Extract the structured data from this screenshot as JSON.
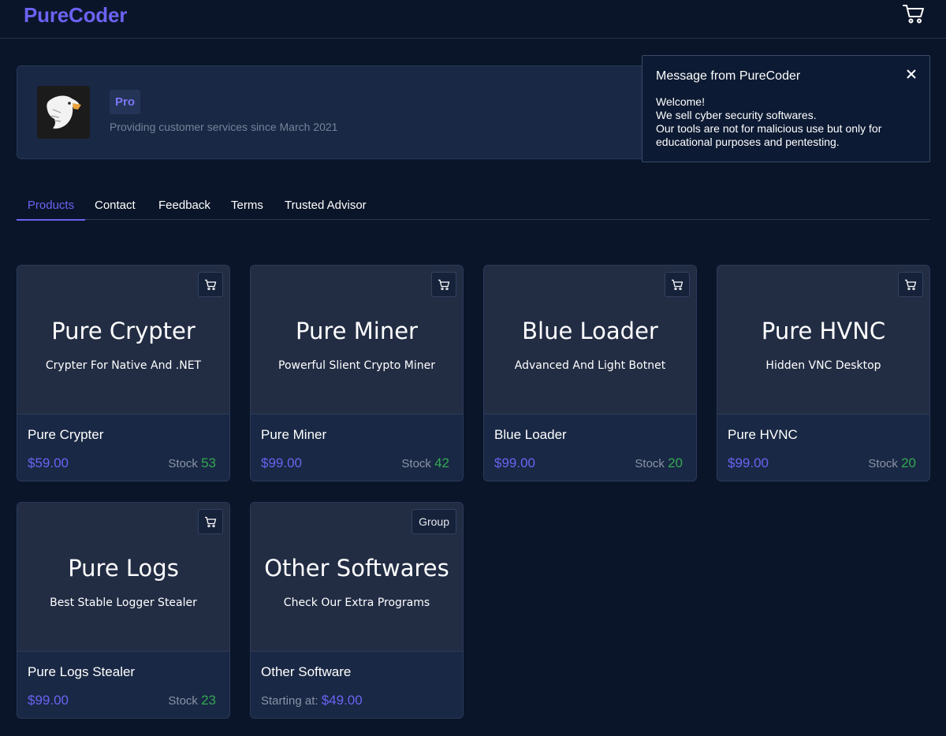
{
  "header": {
    "brand": "PureCoder",
    "cart_icon": "cart-icon"
  },
  "profile": {
    "avatar": "eagle-logo",
    "badge": "Pro",
    "since": "Providing customer services since March 2021"
  },
  "toast": {
    "title": "Message from PureCoder",
    "lines": [
      "Welcome!",
      "We sell cyber security softwares.",
      "Our tools are not for malicious use but only for",
      "educational purposes and pentesting."
    ]
  },
  "tabs": [
    {
      "label": "Products"
    },
    {
      "label": "Contact"
    },
    {
      "label": "Feedback"
    },
    {
      "label": "Terms"
    },
    {
      "label": "Trusted Advisor"
    }
  ],
  "products": [
    {
      "title": "Pure Crypter",
      "subtitle": "Crypter For Native And .NET",
      "name": "Pure Crypter",
      "price": "$59.00",
      "stock_label": "Stock",
      "stock": "53"
    },
    {
      "title": "Pure Miner",
      "subtitle": "Powerful Slient Crypto Miner",
      "name": "Pure Miner",
      "price": "$99.00",
      "stock_label": "Stock",
      "stock": "42"
    },
    {
      "title": "Blue Loader",
      "subtitle": "Advanced And Light Botnet",
      "name": "Blue Loader",
      "price": "$99.00",
      "stock_label": "Stock",
      "stock": "20"
    },
    {
      "title": "Pure HVNC",
      "subtitle": "Hidden VNC Desktop",
      "name": "Pure HVNC",
      "price": "$99.00",
      "stock_label": "Stock",
      "stock": "20"
    },
    {
      "title": "Pure Logs",
      "subtitle": "Best Stable Logger Stealer",
      "name": "Pure Logs Stealer",
      "price": "$99.00",
      "stock_label": "Stock",
      "stock": "23"
    },
    {
      "title": "Other Softwares",
      "subtitle": "Check Our Extra Programs",
      "name": "Other Software",
      "badge": "Group",
      "starting_label": "Starting at:",
      "price": "$49.00"
    }
  ],
  "colors": {
    "background": "#0b1529",
    "accent": "#6b63f2",
    "stock": "#34a853"
  }
}
